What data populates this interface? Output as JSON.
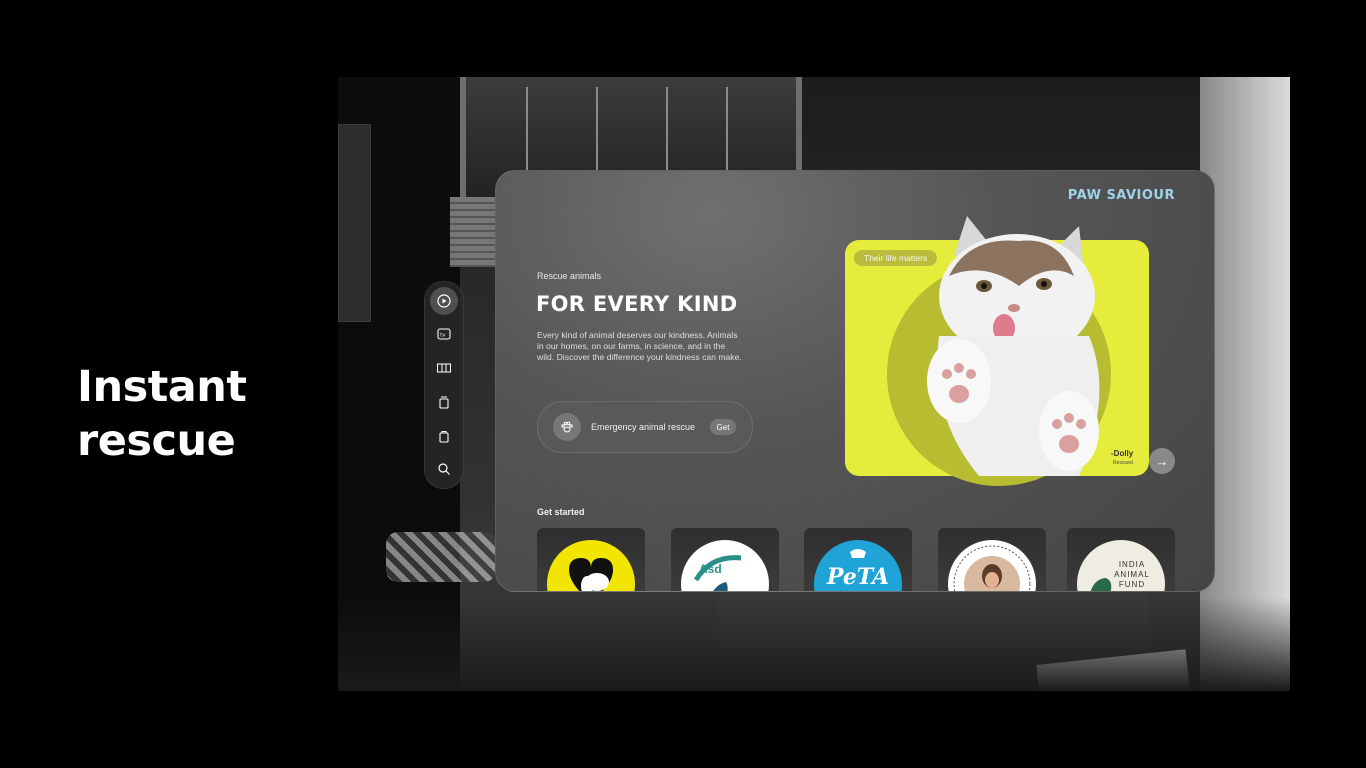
{
  "hero": {
    "line1": "Instant",
    "line2": "rescue"
  },
  "sidebar": {
    "items": [
      {
        "icon": "play-icon",
        "active": true
      },
      {
        "icon": "tv-icon",
        "active": false
      },
      {
        "icon": "grid-icon",
        "active": false
      },
      {
        "icon": "layers-icon",
        "active": false
      },
      {
        "icon": "bag-icon",
        "active": false
      },
      {
        "icon": "search-icon",
        "active": false
      }
    ]
  },
  "panel": {
    "brand": "PAW SAVIOUR",
    "eyebrow": "Rescue animals",
    "headline": "FOR EVERY KIND",
    "description": "Every kind of animal deserves our kindness. Animals in our homes, on our farms, in science, and in the wild. Discover the difference your kindness can make.",
    "rescue": {
      "label": "Emergency animal rescue",
      "button": "Get",
      "icon": "paw-icon"
    },
    "featured": {
      "tag": "Their life matters",
      "name": "-Dolly",
      "status": "Rescued",
      "accent": "#e6ec3c"
    },
    "next_icon": "arrow-right-icon",
    "next_label": "→",
    "get_started": "Get started",
    "orgs": [
      {
        "logo_text": "",
        "bg": "#f2e600"
      },
      {
        "logo_text": "Asd",
        "bg": "#ffffff"
      },
      {
        "logo_text": "PeTA",
        "bg": "#20a4d8"
      },
      {
        "logo_text": "",
        "bg": "#ffffff"
      },
      {
        "logo_text": "INDIA ANIMAL FUND",
        "bg": "#efece2"
      }
    ]
  }
}
